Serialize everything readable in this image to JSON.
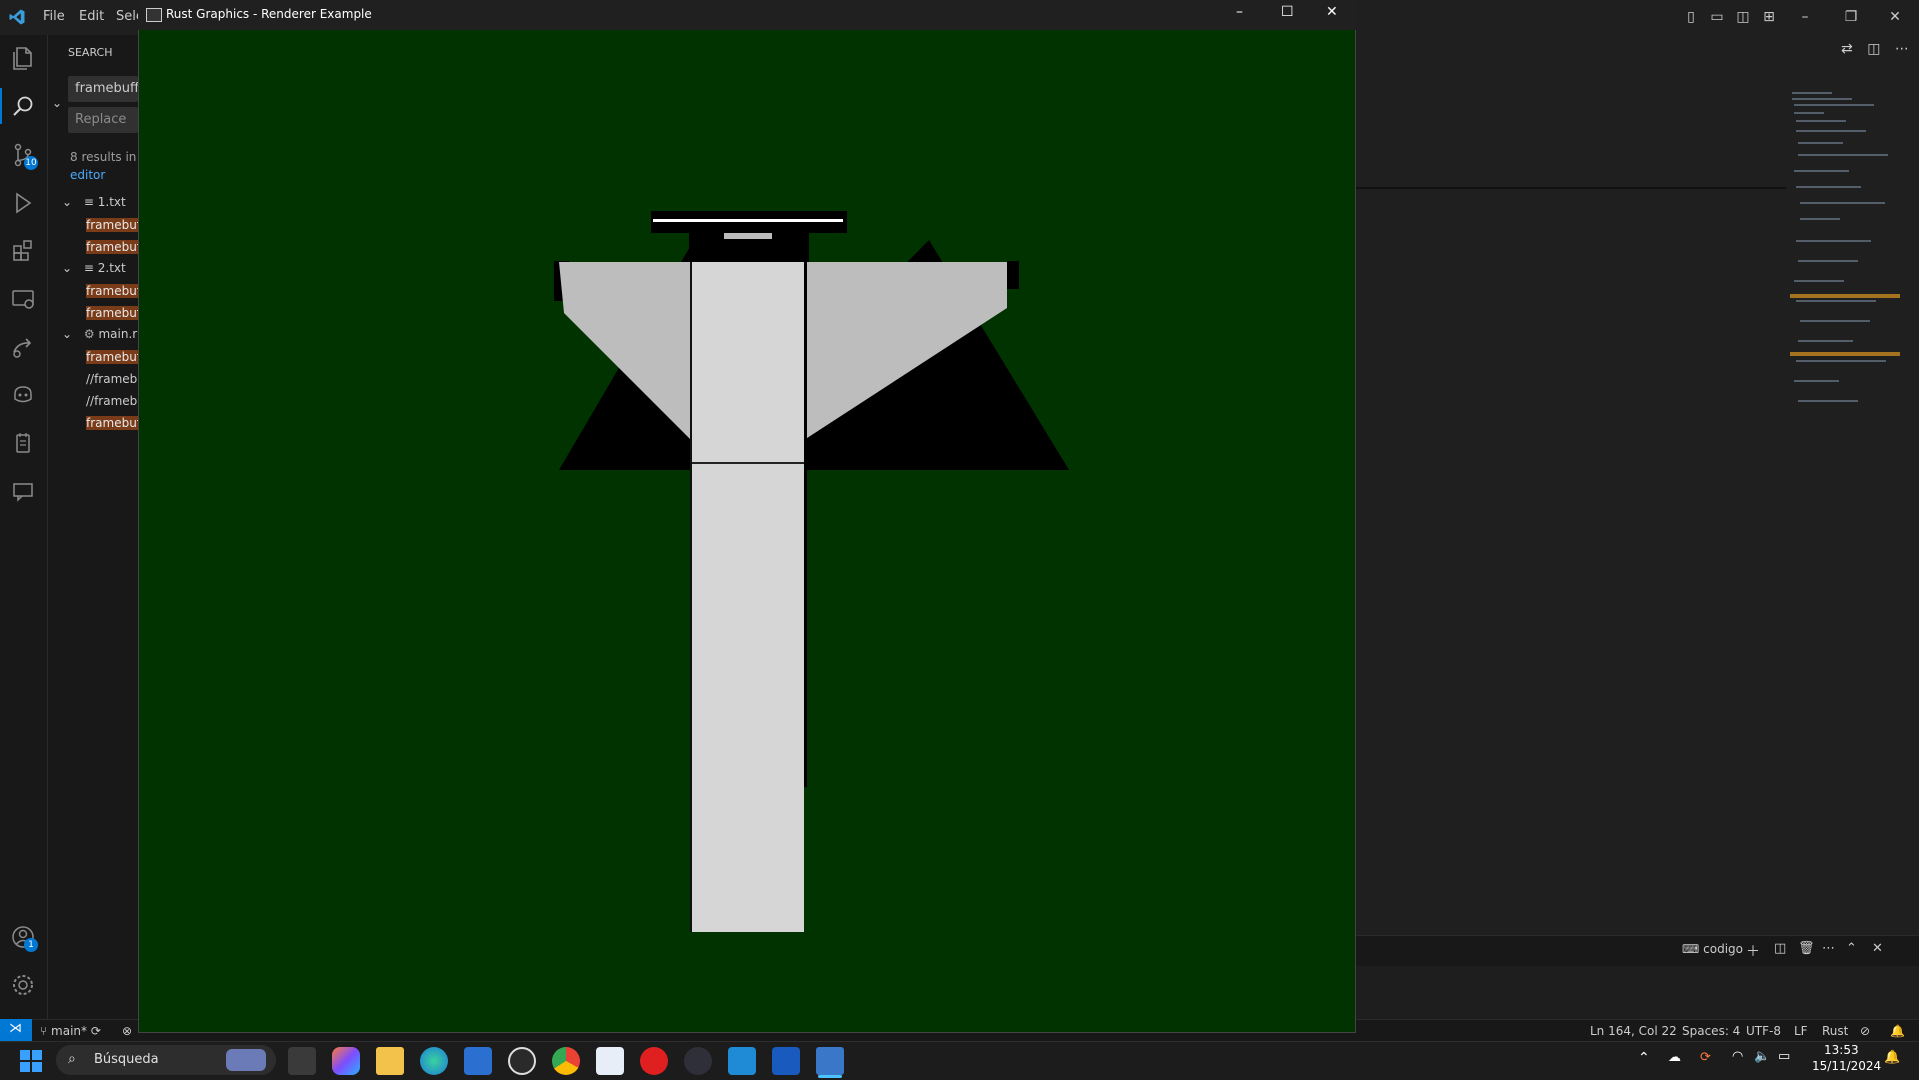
{
  "vscode": {
    "menu": [
      "File",
      "Edit",
      "Sele"
    ],
    "search": {
      "title": "SEARCH",
      "query": "framebuffe",
      "replace_placeholder": "Replace",
      "summary": "8 results in",
      "summary_link": "editor"
    },
    "results": [
      {
        "file": "1.txt",
        "matches": [
          "framebuf",
          "framebuf"
        ]
      },
      {
        "file": "2.txt",
        "matches": [
          "framebuf",
          "framebuf"
        ]
      },
      {
        "file": "main.r",
        "matches": [
          "framebuf",
          "//frameb",
          "//frameb",
          "framebuf"
        ]
      }
    ],
    "activity_badges": {
      "source_control": "10",
      "accounts": "1"
    },
    "panel": {
      "terminal_name": "codigo"
    },
    "status": {
      "branch": "main*",
      "position": "Ln 164, Col 22",
      "spaces": "Spaces: 4",
      "encoding": "UTF-8",
      "eol": "LF",
      "language": "Rust"
    }
  },
  "renderer_window": {
    "title": "Rust Graphics - Renderer Example",
    "background_color": "#003300"
  },
  "taskbar": {
    "search_placeholder": "Búsqueda",
    "time": "13:53",
    "date": "15/11/2024"
  }
}
